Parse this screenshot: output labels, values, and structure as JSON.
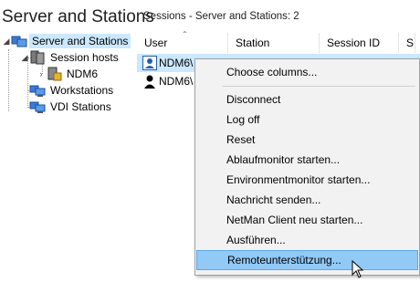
{
  "left_panel": {
    "title": "Server and Stations",
    "tree": [
      {
        "label": "Server and Stations",
        "selected": true,
        "icon": "server-group-icon"
      },
      {
        "label": "Session hosts",
        "icon": "session-hosts-icon"
      },
      {
        "label": "NDM6",
        "icon": "host-computer-icon"
      },
      {
        "label": "Workstations",
        "icon": "workstations-icon"
      },
      {
        "label": "VDI Stations",
        "icon": "vdi-stations-icon"
      }
    ]
  },
  "right_panel": {
    "heading": "Sessions - Server and Stations: 2",
    "columns": [
      "User",
      "Station",
      "Session ID",
      "S"
    ],
    "rows": [
      {
        "user": "NDM6\\",
        "selected": true
      },
      {
        "user": "NDM6\\",
        "selected": false
      }
    ]
  },
  "context_menu": {
    "items": [
      "Choose columns...",
      "Disconnect",
      "Log off",
      "Reset",
      "Ablaufmonitor starten...",
      "Environmentmonitor starten...",
      "Nachricht senden...",
      "NetMan Client neu starten...",
      "Ausführen...",
      "Remoteunterstützung..."
    ],
    "hovered_item": "Remoteunterstützung..."
  },
  "colors": {
    "selection": "#cce8ff",
    "menu_hover": "#91c9f7"
  }
}
